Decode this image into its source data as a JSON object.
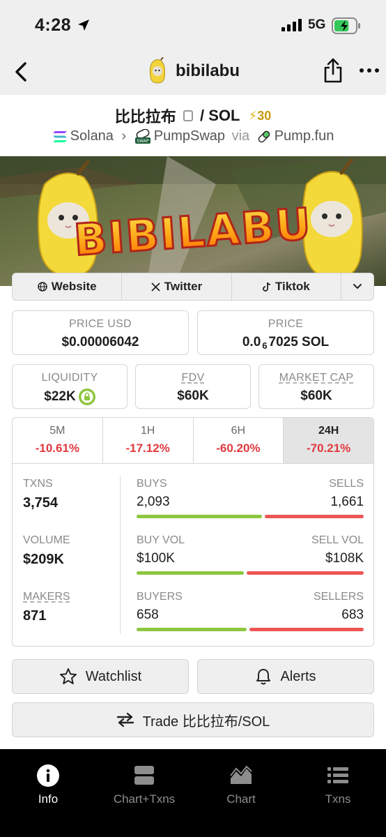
{
  "status_bar": {
    "time": "4:28",
    "network": "5G",
    "battery_level": 0.7
  },
  "nav": {
    "title": "bibilabu"
  },
  "pair": {
    "base": "比比拉布",
    "separator": "/",
    "quote": "SOL",
    "boost_count": "30",
    "chain": "Solana",
    "dex": "PumpSwap",
    "via_label": "via",
    "launchpad": "Pump.fun",
    "dex_badge": "SWAP"
  },
  "banner": {
    "text": "BIBILABU"
  },
  "social": {
    "website": "Website",
    "twitter": "Twitter",
    "tiktok": "Tiktok"
  },
  "price": {
    "usd_label": "PRICE USD",
    "usd_value": "$0.00006042",
    "native_label": "PRICE",
    "native_prefix": "0.0",
    "native_zeros": "6",
    "native_suffix": "7025 SOL"
  },
  "metrics": {
    "liquidity_label": "LIQUIDITY",
    "liquidity_value": "$22K",
    "fdv_label": "FDV",
    "fdv_value": "$60K",
    "mcap_label": "MARKET CAP",
    "mcap_value": "$60K"
  },
  "timeframes": [
    {
      "label": "5M",
      "change": "-10.61%"
    },
    {
      "label": "1H",
      "change": "-17.12%"
    },
    {
      "label": "6H",
      "change": "-60.20%"
    },
    {
      "label": "24H",
      "change": "-70.21%"
    }
  ],
  "active_timeframe": "24H",
  "stats": {
    "txns_label": "TXNS",
    "txns_value": "3,754",
    "volume_label": "VOLUME",
    "volume_value": "$209K",
    "makers_label": "MAKERS",
    "makers_value": "871",
    "buys_label": "BUYS",
    "buys_value": "2,093",
    "sells_label": "SELLS",
    "sells_value": "1,661",
    "buyvol_label": "BUY VOL",
    "buyvol_value": "$100K",
    "sellvol_label": "SELL VOL",
    "sellvol_value": "$108K",
    "buyers_label": "BUYERS",
    "buyers_value": "658",
    "sellers_label": "SELLERS",
    "sellers_value": "683",
    "buys_ratio": 0.557,
    "buyvol_ratio": 0.48,
    "buyers_ratio": 0.49
  },
  "actions": {
    "watchlist": "Watchlist",
    "alerts": "Alerts",
    "trade": "Trade 比比拉布/SOL"
  },
  "tabbar": [
    {
      "label": "Info",
      "icon": "info-icon"
    },
    {
      "label": "Chart+Txns",
      "icon": "split-view-icon"
    },
    {
      "label": "Chart",
      "icon": "area-chart-icon"
    },
    {
      "label": "Txns",
      "icon": "list-icon"
    }
  ],
  "active_tab": "Info",
  "colors": {
    "positive": "#8dc63f",
    "negative": "#e0393e",
    "boost": "#c99a10",
    "tabbar_bg": "#000000"
  }
}
